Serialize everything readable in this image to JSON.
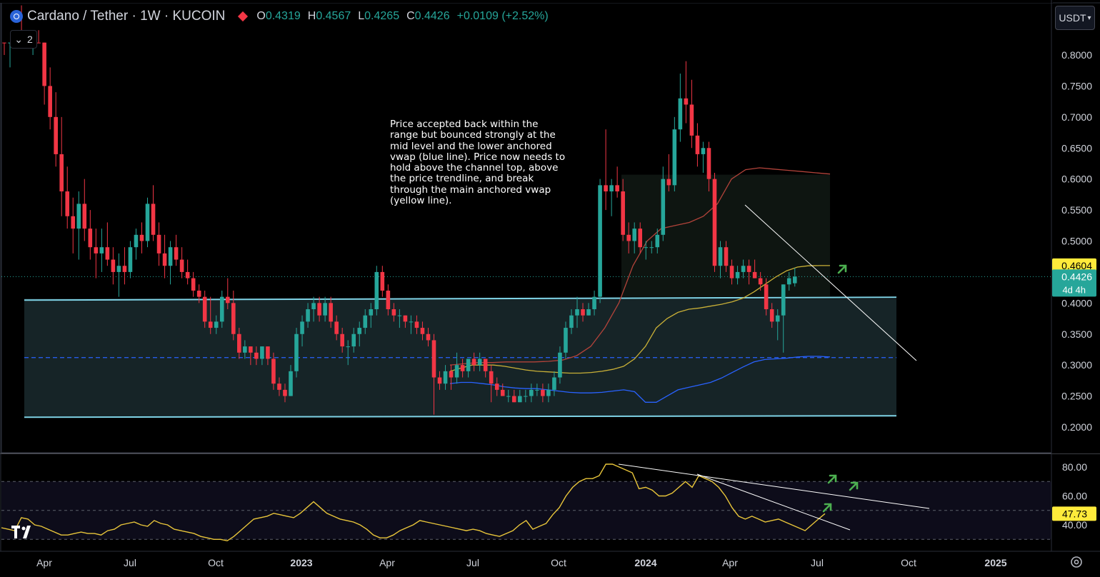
{
  "header": {
    "symbol": "Cardano / Tether · 1W · KUCOIN",
    "ohlc": {
      "o_label": "O",
      "o": "0.4319",
      "h_label": "H",
      "h": "0.4567",
      "l_label": "L",
      "l": "0.4265",
      "c_label": "C",
      "c": "0.4426",
      "change": "+0.0109 (+2.52%)"
    },
    "indicator_count": "2",
    "currency_button": "USDT"
  },
  "annotation": "Price accepted back within the\nrange but bounced strongly at the\nmid level and the lower anchored\nvwap (blue line). Price now needs to\nhold above the channel top, above\nthe price trendline, and break\nthrough the main anchored vwap\n(yellow line).",
  "colors": {
    "up": "#26a69a",
    "down": "#f23645",
    "range": "#7fd3e6",
    "vwap_main": "#c9b037",
    "vwap_low": "#2962ff",
    "vwap_top": "#b2433a",
    "rsi": "#e8c53a"
  },
  "chart_data": [
    {
      "type": "candlestick",
      "title": "Cardano / Tether · 1W · KUCOIN",
      "ylim": [
        0.18,
        0.82
      ],
      "y_ticks": [
        "0.8000",
        "0.7500",
        "0.7000",
        "0.6500",
        "0.6000",
        "0.5500",
        "0.5000",
        "0.4500",
        "0.4000",
        "0.3500",
        "0.3000",
        "0.2500",
        "0.2000"
      ],
      "x_ticks": [
        "Apr",
        "Jul",
        "Oct",
        "2023",
        "Apr",
        "Jul",
        "Oct",
        "2024",
        "Apr",
        "Jul",
        "Oct",
        "2025"
      ],
      "last_price": "0.4426",
      "last_price_countdown": "4d 4h",
      "vwap_main_price": "0.4604",
      "range_top": 0.407,
      "range_bottom": 0.217,
      "range_mid": 0.312,
      "candles": [
        [
          0.85,
          0.9,
          0.8,
          0.82
        ],
        [
          0.82,
          0.86,
          0.78,
          0.84
        ],
        [
          0.84,
          0.96,
          0.82,
          0.93
        ],
        [
          0.93,
          1.02,
          0.88,
          0.9
        ],
        [
          0.9,
          0.93,
          0.82,
          0.84
        ],
        [
          0.84,
          0.9,
          0.8,
          0.88
        ],
        [
          0.88,
          0.92,
          0.84,
          0.86
        ],
        [
          0.86,
          0.88,
          0.72,
          0.75
        ],
        [
          0.75,
          0.78,
          0.68,
          0.7
        ],
        [
          0.7,
          0.74,
          0.62,
          0.64
        ],
        [
          0.64,
          0.7,
          0.54,
          0.58
        ],
        [
          0.58,
          0.62,
          0.52,
          0.54
        ],
        [
          0.54,
          0.57,
          0.48,
          0.52
        ],
        [
          0.52,
          0.58,
          0.47,
          0.56
        ],
        [
          0.56,
          0.6,
          0.5,
          0.52
        ],
        [
          0.52,
          0.55,
          0.47,
          0.49
        ],
        [
          0.49,
          0.52,
          0.44,
          0.48
        ],
        [
          0.48,
          0.52,
          0.45,
          0.49
        ],
        [
          0.49,
          0.53,
          0.46,
          0.47
        ],
        [
          0.47,
          0.49,
          0.43,
          0.45
        ],
        [
          0.45,
          0.48,
          0.41,
          0.46
        ],
        [
          0.46,
          0.49,
          0.43,
          0.45
        ],
        [
          0.45,
          0.5,
          0.44,
          0.49
        ],
        [
          0.49,
          0.52,
          0.47,
          0.51
        ],
        [
          0.51,
          0.53,
          0.48,
          0.5
        ],
        [
          0.5,
          0.57,
          0.49,
          0.56
        ],
        [
          0.56,
          0.59,
          0.5,
          0.51
        ],
        [
          0.51,
          0.53,
          0.46,
          0.48
        ],
        [
          0.48,
          0.51,
          0.44,
          0.46
        ],
        [
          0.46,
          0.5,
          0.43,
          0.49
        ],
        [
          0.49,
          0.51,
          0.46,
          0.47
        ],
        [
          0.47,
          0.49,
          0.44,
          0.45
        ],
        [
          0.45,
          0.47,
          0.43,
          0.44
        ],
        [
          0.44,
          0.45,
          0.41,
          0.42
        ],
        [
          0.42,
          0.43,
          0.4,
          0.41
        ],
        [
          0.41,
          0.42,
          0.36,
          0.37
        ],
        [
          0.37,
          0.41,
          0.35,
          0.36
        ],
        [
          0.36,
          0.38,
          0.35,
          0.37
        ],
        [
          0.37,
          0.42,
          0.36,
          0.41
        ],
        [
          0.41,
          0.44,
          0.39,
          0.4
        ],
        [
          0.4,
          0.42,
          0.34,
          0.35
        ],
        [
          0.35,
          0.36,
          0.31,
          0.32
        ],
        [
          0.32,
          0.34,
          0.31,
          0.33
        ],
        [
          0.33,
          0.33,
          0.3,
          0.32
        ],
        [
          0.32,
          0.33,
          0.3,
          0.31
        ],
        [
          0.31,
          0.33,
          0.3,
          0.33
        ],
        [
          0.33,
          0.33,
          0.3,
          0.31
        ],
        [
          0.31,
          0.32,
          0.26,
          0.27
        ],
        [
          0.27,
          0.28,
          0.25,
          0.26
        ],
        [
          0.26,
          0.27,
          0.24,
          0.25
        ],
        [
          0.25,
          0.3,
          0.25,
          0.29
        ],
        [
          0.29,
          0.36,
          0.28,
          0.35
        ],
        [
          0.35,
          0.38,
          0.33,
          0.37
        ],
        [
          0.37,
          0.4,
          0.36,
          0.39
        ],
        [
          0.39,
          0.41,
          0.37,
          0.4
        ],
        [
          0.4,
          0.41,
          0.37,
          0.38
        ],
        [
          0.38,
          0.41,
          0.37,
          0.4
        ],
        [
          0.4,
          0.41,
          0.36,
          0.37
        ],
        [
          0.37,
          0.38,
          0.34,
          0.35
        ],
        [
          0.35,
          0.36,
          0.32,
          0.33
        ],
        [
          0.33,
          0.34,
          0.3,
          0.33
        ],
        [
          0.33,
          0.36,
          0.32,
          0.35
        ],
        [
          0.35,
          0.37,
          0.33,
          0.36
        ],
        [
          0.36,
          0.39,
          0.35,
          0.38
        ],
        [
          0.38,
          0.4,
          0.36,
          0.39
        ],
        [
          0.39,
          0.46,
          0.38,
          0.45
        ],
        [
          0.45,
          0.46,
          0.41,
          0.42
        ],
        [
          0.42,
          0.43,
          0.38,
          0.39
        ],
        [
          0.39,
          0.4,
          0.37,
          0.38
        ],
        [
          0.38,
          0.39,
          0.36,
          0.38
        ],
        [
          0.38,
          0.38,
          0.36,
          0.37
        ],
        [
          0.37,
          0.38,
          0.35,
          0.37
        ],
        [
          0.37,
          0.38,
          0.35,
          0.36
        ],
        [
          0.36,
          0.37,
          0.34,
          0.35
        ],
        [
          0.35,
          0.36,
          0.33,
          0.34
        ],
        [
          0.34,
          0.35,
          0.22,
          0.28
        ],
        [
          0.28,
          0.29,
          0.26,
          0.27
        ],
        [
          0.27,
          0.3,
          0.26,
          0.29
        ],
        [
          0.29,
          0.3,
          0.26,
          0.28
        ],
        [
          0.28,
          0.32,
          0.27,
          0.3
        ],
        [
          0.3,
          0.31,
          0.28,
          0.29
        ],
        [
          0.29,
          0.31,
          0.28,
          0.31
        ],
        [
          0.31,
          0.32,
          0.29,
          0.3
        ],
        [
          0.3,
          0.32,
          0.29,
          0.31
        ],
        [
          0.31,
          0.31,
          0.28,
          0.29
        ],
        [
          0.29,
          0.3,
          0.24,
          0.27
        ],
        [
          0.27,
          0.28,
          0.25,
          0.26
        ],
        [
          0.26,
          0.27,
          0.25,
          0.25
        ],
        [
          0.25,
          0.26,
          0.24,
          0.25
        ],
        [
          0.25,
          0.26,
          0.24,
          0.24
        ],
        [
          0.24,
          0.26,
          0.24,
          0.25
        ],
        [
          0.25,
          0.26,
          0.24,
          0.25
        ],
        [
          0.25,
          0.27,
          0.24,
          0.26
        ],
        [
          0.26,
          0.27,
          0.25,
          0.26
        ],
        [
          0.26,
          0.27,
          0.24,
          0.25
        ],
        [
          0.25,
          0.27,
          0.24,
          0.26
        ],
        [
          0.26,
          0.29,
          0.25,
          0.28
        ],
        [
          0.28,
          0.33,
          0.27,
          0.32
        ],
        [
          0.32,
          0.37,
          0.31,
          0.36
        ],
        [
          0.36,
          0.39,
          0.35,
          0.38
        ],
        [
          0.38,
          0.41,
          0.36,
          0.39
        ],
        [
          0.39,
          0.4,
          0.37,
          0.38
        ],
        [
          0.38,
          0.4,
          0.38,
          0.39
        ],
        [
          0.39,
          0.42,
          0.38,
          0.41
        ],
        [
          0.41,
          0.6,
          0.4,
          0.59
        ],
        [
          0.59,
          0.68,
          0.55,
          0.58
        ],
        [
          0.58,
          0.6,
          0.54,
          0.59
        ],
        [
          0.59,
          0.62,
          0.57,
          0.58
        ],
        [
          0.58,
          0.6,
          0.5,
          0.51
        ],
        [
          0.51,
          0.53,
          0.48,
          0.5
        ],
        [
          0.5,
          0.53,
          0.48,
          0.52
        ],
        [
          0.52,
          0.53,
          0.48,
          0.49
        ],
        [
          0.49,
          0.5,
          0.47,
          0.49
        ],
        [
          0.49,
          0.5,
          0.48,
          0.49
        ],
        [
          0.49,
          0.52,
          0.48,
          0.51
        ],
        [
          0.51,
          0.62,
          0.5,
          0.6
        ],
        [
          0.6,
          0.64,
          0.58,
          0.59
        ],
        [
          0.59,
          0.7,
          0.58,
          0.68
        ],
        [
          0.68,
          0.77,
          0.66,
          0.73
        ],
        [
          0.73,
          0.79,
          0.69,
          0.72
        ],
        [
          0.72,
          0.76,
          0.65,
          0.67
        ],
        [
          0.67,
          0.69,
          0.62,
          0.64
        ],
        [
          0.64,
          0.66,
          0.61,
          0.65
        ],
        [
          0.65,
          0.66,
          0.58,
          0.6
        ],
        [
          0.6,
          0.61,
          0.45,
          0.46
        ],
        [
          0.46,
          0.5,
          0.44,
          0.49
        ],
        [
          0.49,
          0.5,
          0.45,
          0.46
        ],
        [
          0.46,
          0.47,
          0.43,
          0.44
        ],
        [
          0.44,
          0.46,
          0.43,
          0.45
        ],
        [
          0.45,
          0.47,
          0.44,
          0.46
        ],
        [
          0.46,
          0.47,
          0.43,
          0.45
        ],
        [
          0.45,
          0.47,
          0.44,
          0.44
        ],
        [
          0.44,
          0.45,
          0.42,
          0.43
        ],
        [
          0.43,
          0.44,
          0.38,
          0.39
        ],
        [
          0.39,
          0.4,
          0.36,
          0.37
        ],
        [
          0.37,
          0.39,
          0.34,
          0.38
        ],
        [
          0.38,
          0.43,
          0.32,
          0.43
        ],
        [
          0.43,
          0.45,
          0.42,
          0.44
        ],
        [
          0.4319,
          0.4567,
          0.4265,
          0.4426
        ]
      ],
      "vwap_main": [
        0.29,
        0.295,
        0.3,
        0.3,
        0.3,
        0.298,
        0.295,
        0.292,
        0.29,
        0.289,
        0.288,
        0.287,
        0.287,
        0.288,
        0.29,
        0.293,
        0.298,
        0.31,
        0.33,
        0.36,
        0.375,
        0.385,
        0.39,
        0.392,
        0.395,
        0.398,
        0.402,
        0.408,
        0.418,
        0.43,
        0.442,
        0.452,
        0.458,
        0.46,
        0.4604,
        0.4604
      ],
      "vwap_low": [
        0.27,
        0.272,
        0.272,
        0.27,
        0.268,
        0.265,
        0.263,
        0.262,
        0.262,
        0.26,
        0.258,
        0.256,
        0.255,
        0.255,
        0.256,
        0.258,
        0.26,
        0.257,
        0.24,
        0.24,
        0.25,
        0.26,
        0.264,
        0.268,
        0.272,
        0.279,
        0.288,
        0.297,
        0.305,
        0.309,
        0.31,
        0.311,
        0.313,
        0.314,
        0.314,
        0.313
      ],
      "vwap_top": [
        0.3,
        0.302,
        0.304,
        0.304,
        0.305,
        0.305,
        0.305,
        0.306,
        0.308,
        0.315,
        0.33,
        0.36,
        0.4,
        0.46,
        0.5,
        0.52,
        0.525,
        0.53,
        0.54,
        0.56,
        0.6,
        0.615,
        0.618,
        0.616,
        0.614,
        0.612,
        0.61,
        0.608
      ]
    },
    {
      "type": "line",
      "title": "RSI",
      "ylim": [
        27,
        88
      ],
      "y_ticks": [
        "80.00",
        "60.00",
        "40.00"
      ],
      "last_value": "47.73",
      "values": [
        38,
        37,
        36,
        45,
        44,
        40,
        39,
        37,
        35,
        33,
        33,
        34,
        35,
        34,
        34,
        33,
        36,
        37,
        40,
        41,
        42,
        40,
        39,
        43,
        41,
        40,
        37,
        36,
        35,
        34,
        32,
        31,
        30,
        30,
        29,
        32,
        36,
        40,
        44,
        45,
        46,
        48,
        47,
        46,
        45,
        48,
        52,
        56,
        52,
        48,
        46,
        44,
        43,
        42,
        40,
        37,
        33,
        31,
        31,
        33,
        36,
        38,
        40,
        43,
        42,
        41,
        40,
        39,
        38,
        37,
        36,
        37,
        36,
        34,
        33,
        32,
        34,
        36,
        40,
        43,
        37,
        39,
        41,
        47,
        52,
        60,
        66,
        70,
        72,
        72,
        74,
        82,
        82,
        80,
        78,
        76,
        65,
        66,
        64,
        60,
        60,
        62,
        66,
        70,
        66,
        74,
        72,
        70,
        66,
        60,
        52,
        46,
        44,
        46,
        44,
        42,
        43,
        44,
        42,
        40,
        38,
        36,
        40,
        44,
        47.73
      ]
    }
  ]
}
